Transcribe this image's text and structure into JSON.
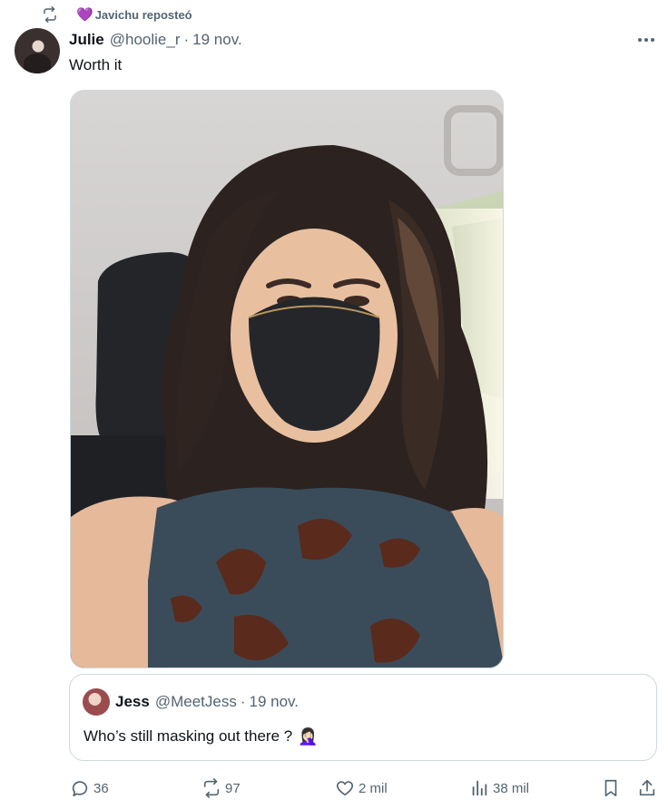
{
  "repost": {
    "heart": "💜",
    "label": "Javichu reposteó"
  },
  "tweet": {
    "name": "Julie",
    "handle": "@hoolie_r",
    "separator": "·",
    "date": "19 nov.",
    "text": "Worth it"
  },
  "quote": {
    "name": "Jess",
    "handle": "@MeetJess",
    "separator": "·",
    "date": "19 nov.",
    "text": "Who’s still masking out there ?",
    "emoji": "🤦🏻‍♀️"
  },
  "actions": {
    "replies": "36",
    "reposts": "97",
    "likes": "2 mil",
    "views": "38 mil"
  },
  "icons": {
    "repost": "repost-icon",
    "more": "more-icon",
    "reply": "reply-icon",
    "like": "heart-icon",
    "views": "views-icon",
    "bookmark": "bookmark-icon",
    "share": "share-icon"
  },
  "colors": {
    "text": "#0f1419",
    "muted": "#536471",
    "border": "#cfd9de"
  }
}
